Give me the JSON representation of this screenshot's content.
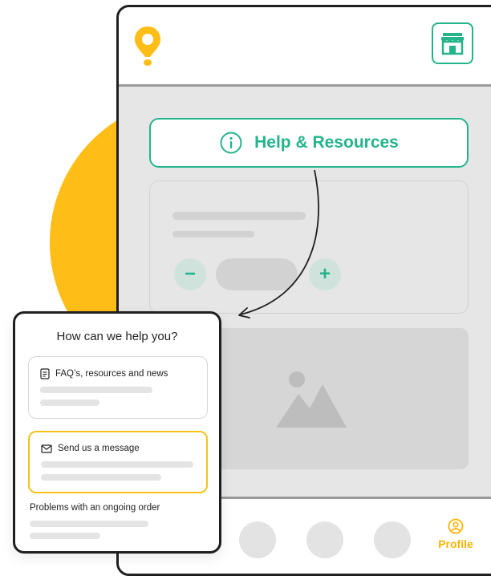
{
  "colors": {
    "accent": "#24B48B",
    "brand_yellow": "#FFBE17",
    "highlight": "#F6C21A",
    "frame": "#1f1f1f",
    "placeholder": "#d2d2d2"
  },
  "header": {
    "logo_icon": "map-pin-icon",
    "store_icon": "storefront-icon"
  },
  "help_button": {
    "icon": "info-icon",
    "label": "Help & Resources"
  },
  "product_card": {
    "decrement_label": "−",
    "increment_label": "+"
  },
  "bottom_nav": {
    "profile_icon": "user-circle-icon",
    "profile_label": "Profile"
  },
  "help_popup": {
    "title": "How can we help you?",
    "options": [
      {
        "icon": "document-icon",
        "label": "FAQ’s, resources and news"
      },
      {
        "icon": "envelope-icon",
        "label": "Send us a message"
      }
    ],
    "orders_label": "Problems with an ongoing order"
  }
}
